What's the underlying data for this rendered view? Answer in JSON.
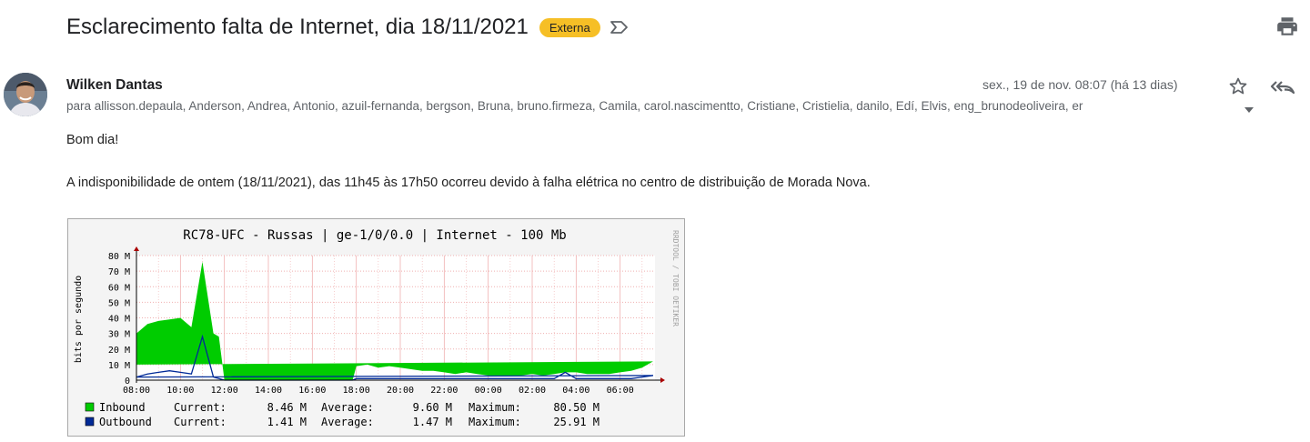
{
  "email": {
    "subject": "Esclarecimento falta de Internet, dia 18/11/2021",
    "label": "Externa",
    "sender_name": "Wilken Dantas",
    "date": "sex., 19 de nov. 08:07 (há 13 dias)",
    "recipients": "para allisson.depaula, Anderson, Andrea, Antonio, azuil-fernanda, bergson, Bruna, bruno.firmeza, Camila, carol.nascimentto, Cristiane, Cristielia, danilo, Edí, Elvis, eng_brunodeoliveira, er",
    "greeting": "Bom dia!",
    "paragraph": "A indisponibilidade de ontem (18/11/2021), das 11h45 às 17h50 ocorreu devido à falha elétrica no centro de distribuição de Morada Nova."
  },
  "icons": {
    "label": "label-outline-icon",
    "print": "print-icon",
    "star": "star-outline-icon",
    "reply": "reply-all-icon",
    "caret": "caret-down-icon"
  },
  "colors": {
    "badge": "#f6bf26",
    "inbound": "#00cc00",
    "outbound": "#002a97",
    "grid": "#f2b8b8"
  },
  "chart_data": {
    "type": "area",
    "title": "RC78-UFC - Russas | ge-1/0/0.0 | Internet - 100 Mb",
    "ylabel": "bits por segundo",
    "watermark": "RRDTOOL / TOBI OETIKER",
    "ylim": [
      0,
      80
    ],
    "unit": "M",
    "y_ticks": [
      "0",
      "10 M",
      "20 M",
      "30 M",
      "40 M",
      "50 M",
      "60 M",
      "70 M",
      "80 M"
    ],
    "x_ticks": [
      "08:00",
      "10:00",
      "12:00",
      "14:00",
      "16:00",
      "18:00",
      "20:00",
      "22:00",
      "00:00",
      "02:00",
      "04:00",
      "06:00"
    ],
    "x": [
      "08:00",
      "08:30",
      "09:00",
      "09:30",
      "10:00",
      "10:30",
      "11:00",
      "11:30",
      "11:45",
      "12:00",
      "14:00",
      "16:00",
      "17:50",
      "18:00",
      "18:30",
      "19:00",
      "19:30",
      "20:00",
      "20:30",
      "21:00",
      "21:30",
      "22:00",
      "22:30",
      "23:00",
      "23:30",
      "00:00",
      "00:30",
      "01:00",
      "01:30",
      "02:00",
      "02:30",
      "03:00",
      "03:30",
      "04:00",
      "04:30",
      "05:00",
      "05:30",
      "06:00",
      "06:30",
      "07:00",
      "07:30",
      "08:00"
    ],
    "series": [
      {
        "name": "Inbound",
        "values": [
          30,
          36,
          38,
          39,
          40,
          34,
          76,
          30,
          28,
          0,
          0,
          0,
          0,
          9,
          10,
          8,
          9,
          8,
          7,
          6,
          6,
          5,
          4,
          5,
          4,
          3,
          3,
          3,
          3,
          4,
          3,
          4,
          5,
          5,
          4,
          4,
          4,
          5,
          6,
          8,
          12,
          10
        ]
      },
      {
        "name": "Outbound",
        "values": [
          2,
          4,
          5,
          6,
          5,
          4,
          28,
          2,
          1,
          0,
          0,
          0,
          0,
          1,
          1,
          1,
          1,
          1,
          1,
          1,
          1,
          1,
          1,
          1,
          1,
          1,
          1,
          1,
          1,
          1,
          1,
          1,
          5,
          1,
          1,
          1,
          1,
          1,
          1,
          2,
          3,
          2
        ]
      }
    ],
    "legend": [
      {
        "name": "Inbound",
        "current_label": "Current:",
        "current": "8.46 M",
        "average_label": "Average:",
        "average": "9.60 M",
        "maximum_label": "Maximum:",
        "maximum": "80.50 M"
      },
      {
        "name": "Outbound",
        "current_label": "Current:",
        "current": "1.41 M",
        "average_label": "Average:",
        "average": "1.47 M",
        "maximum_label": "Maximum:",
        "maximum": "25.91 M"
      }
    ]
  }
}
